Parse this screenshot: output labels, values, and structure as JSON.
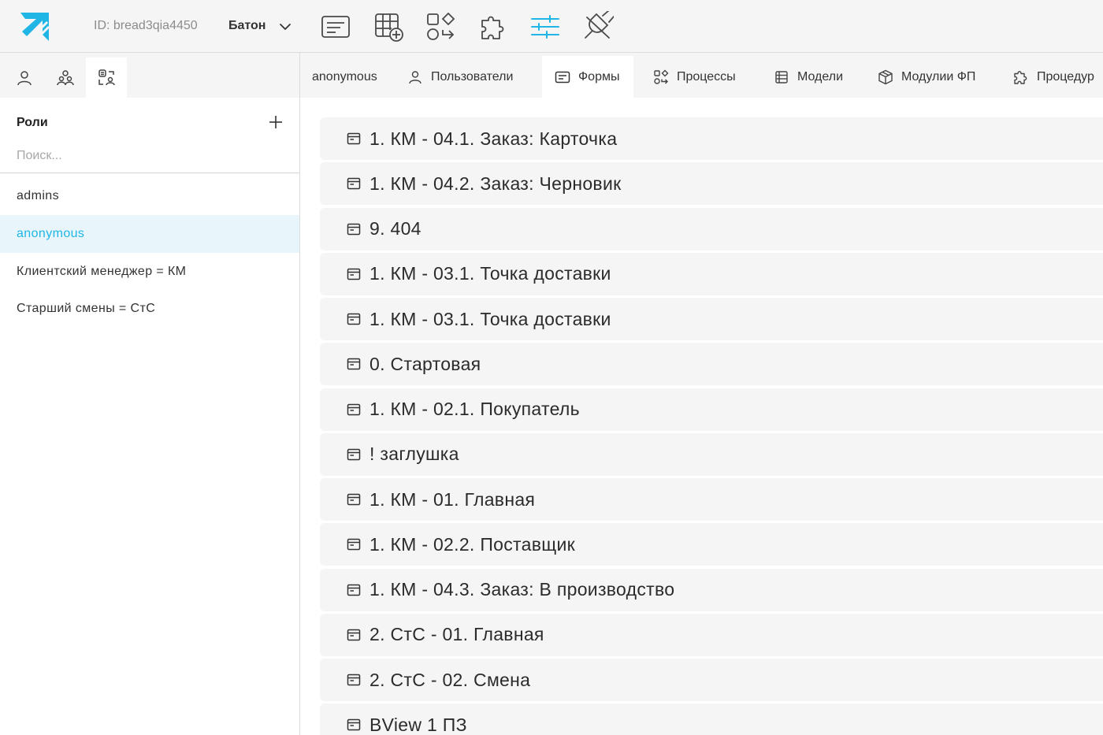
{
  "header": {
    "project_id": "ID: bread3qia4450",
    "project_name": "Батон",
    "brand_color": "#1fb6e6",
    "toolbar_icons": [
      "forms-icon",
      "table-add-icon",
      "shapes-icon",
      "puzzle-icon",
      "sliders-icon",
      "plug-icon"
    ],
    "active_tool": "sliders-icon"
  },
  "sidebar": {
    "tabs": [
      "user-icon",
      "users-group-icon",
      "roles-icon"
    ],
    "active_tab": "roles-icon",
    "roles_title": "Роли",
    "search_placeholder": "Поиск...",
    "roles": [
      {
        "label": "admins"
      },
      {
        "label": "anonymous",
        "active": true
      },
      {
        "label": "Клиентский менеджер = КМ"
      },
      {
        "label": "Старший смены = СтС"
      }
    ]
  },
  "main": {
    "tabs": [
      {
        "label": "anonymous",
        "icon": ""
      },
      {
        "label": "Пользователи",
        "icon": "user-icon"
      },
      {
        "label": "Формы",
        "icon": "form-icon",
        "active": true
      },
      {
        "label": "Процессы",
        "icon": "processes-icon"
      },
      {
        "label": "Модели",
        "icon": "models-icon"
      },
      {
        "label": "Модулии ФП",
        "icon": "box-icon"
      },
      {
        "label": "Процедур",
        "icon": "puzzle-icon"
      }
    ],
    "forms": [
      "1. КМ - 04.1. Заказ: Карточка",
      "1. КМ - 04.2. Заказ: Черновик",
      "9. 404",
      "1. КМ - 03.1. Точка доставки",
      "1. КМ - 03.1. Точка доставки",
      "0. Стартовая",
      "1. КМ - 02.1. Покупатель",
      "! заглушка",
      "1. КМ - 01. Главная",
      "1. КМ - 02.2. Поставщик",
      "1. КМ - 04.3. Заказ: В производство",
      "2. СтС - 01. Главная",
      "2. СтС - 02. Смена",
      "BView 1 ПЗ"
    ]
  }
}
